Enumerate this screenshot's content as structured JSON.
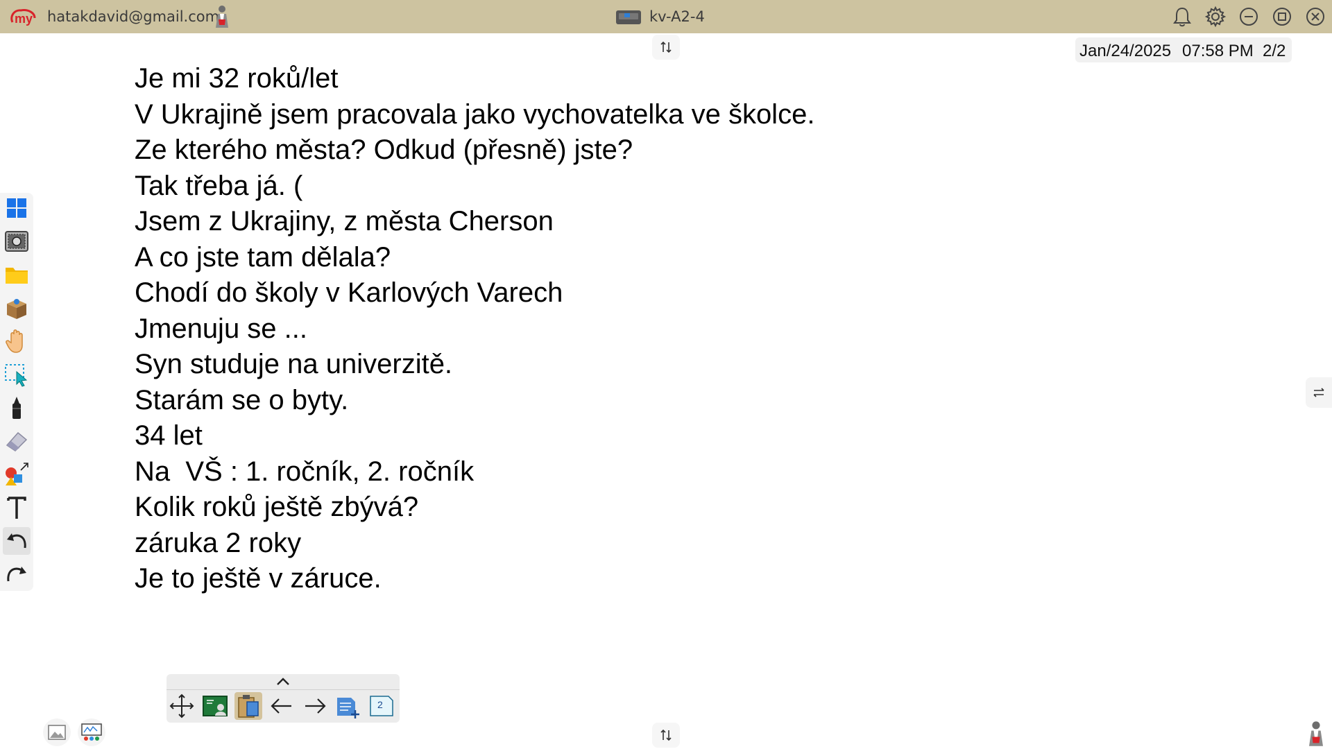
{
  "titlebar": {
    "logo_text": "my",
    "account_email": "hatakdavid@gmail.com",
    "device_name": "kv-A2-4",
    "icons": [
      "notification-bell-icon",
      "settings-gear-icon",
      "minimize-icon",
      "maximize-icon",
      "close-icon"
    ]
  },
  "status": {
    "date": "Jan/24/2025",
    "time": "07:58 PM",
    "page": "2/2"
  },
  "left_toolbar": {
    "tools": [
      "windows-start-icon",
      "screen-capture-icon",
      "folder-icon",
      "apps-box-icon",
      "hand-pan-icon",
      "select-pointer-icon",
      "pen-marker-icon",
      "eraser-icon",
      "shapes-icon",
      "text-tool-icon",
      "undo-icon",
      "redo-icon"
    ]
  },
  "board": {
    "lines": [
      "Je mi 32 roků/let",
      "V Ukrajině jsem pracovala jako vychovatelka ve školce.",
      "Ze kterého města? Odkud (přesně) jste?",
      "Tak třeba já. (",
      "Jsem z Ukrajiny, z města Cherson",
      "A co jste tam dělala?",
      "Chodí do školy v Karlových Varech",
      "Jmenuju se ...",
      "Syn studuje na univerzitě.",
      "Starám se o byty.",
      "34 let",
      "Na  VŠ : 1. ročník, 2. ročník",
      "Kolik roků ještě zbývá?",
      "záruka 2 roky",
      "Je to ještě v záruce."
    ]
  },
  "bottom_toolbar": {
    "page_number": "2",
    "tools": [
      "move-icon",
      "board-background-icon",
      "page-clipboard-icon",
      "previous-page-arrow-icon",
      "next-page-arrow-icon",
      "add-page-icon",
      "page-number-icon"
    ]
  },
  "colors": {
    "titlebar": "#cdc3a0",
    "logo_red": "#d8232a",
    "text": "#000000"
  }
}
